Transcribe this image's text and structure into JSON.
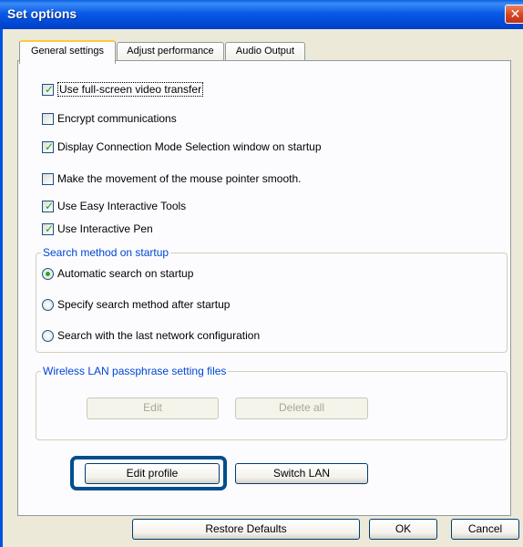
{
  "window": {
    "title": "Set options",
    "close_symbol": "✕"
  },
  "tabs": [
    {
      "label": "General settings",
      "active": true
    },
    {
      "label": "Adjust performance",
      "active": false
    },
    {
      "label": "Audio Output",
      "active": false
    }
  ],
  "checkboxes": [
    {
      "label": "Use full-screen video transfer",
      "checked": true
    },
    {
      "label": "Encrypt communications",
      "checked": false
    },
    {
      "label": "Display Connection Mode Selection window on startup",
      "checked": true
    },
    {
      "label": "Make the movement of the mouse pointer smooth.",
      "checked": false
    },
    {
      "label": "Use Easy Interactive Tools",
      "checked": true
    },
    {
      "label": "Use Interactive Pen",
      "checked": true
    }
  ],
  "search_group": {
    "title": "Search method on startup",
    "options": [
      {
        "label": "Automatic search on startup",
        "selected": true
      },
      {
        "label": "Specify search method after startup",
        "selected": false
      },
      {
        "label": "Search with the last network configuration",
        "selected": false
      }
    ]
  },
  "wireless_group": {
    "title": "Wireless LAN passphrase setting files",
    "edit_label": "Edit",
    "delete_all_label": "Delete all"
  },
  "profile_buttons": {
    "edit_profile_label": "Edit profile",
    "switch_lan_label": "Switch LAN"
  },
  "footer": {
    "restore_defaults_label": "Restore Defaults",
    "ok_label": "OK",
    "cancel_label": "Cancel"
  },
  "colors": {
    "title_bar": "#0054e3",
    "group_title": "#0046d5",
    "highlight_border": "#004f8c"
  }
}
